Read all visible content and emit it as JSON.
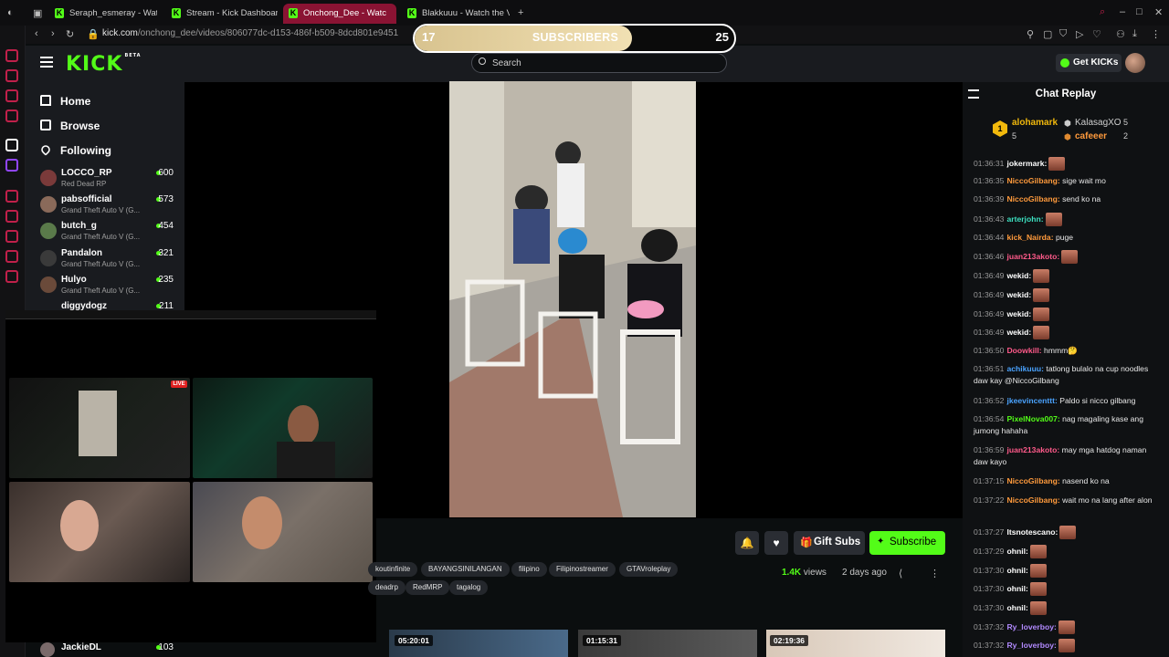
{
  "browser": {
    "tabs": [
      {
        "label": "Seraph_esmeray - Watch"
      },
      {
        "label": "Stream - Kick Dashboard"
      },
      {
        "label": "Onchong_Dee - Watc"
      },
      {
        "label": "Blakkuuu - Watch the VOD"
      }
    ],
    "url_host": "kick.com",
    "url_path": "/onchong_dee/videos/806077dc-d153-486f-b509-8dcd801e9451"
  },
  "overlay": {
    "sub_current": "17",
    "sub_label": "SUBSCRIBERS",
    "sub_goal": "25",
    "sub_progress": 0.68
  },
  "header": {
    "logo": "KICK",
    "logo_tag": "BETA",
    "search_placeholder": "Search",
    "get_kicks": "Get KICKs"
  },
  "sidebar": {
    "nav": [
      {
        "label": "Home"
      },
      {
        "label": "Browse"
      },
      {
        "label": "Following"
      }
    ],
    "channels": [
      {
        "name": "LOCCO_RP",
        "game": "Red Dead RP",
        "viewers": "600"
      },
      {
        "name": "pabsofficial",
        "game": "Grand Theft Auto V (G...",
        "viewers": "573"
      },
      {
        "name": "butch_g",
        "game": "Grand Theft Auto V (G...",
        "viewers": "454"
      },
      {
        "name": "Pandalon",
        "game": "Grand Theft Auto V (G...",
        "viewers": "321"
      },
      {
        "name": "Hulyo",
        "game": "Grand Theft Auto V (G...",
        "viewers": "235"
      },
      {
        "name": "diggydogz",
        "game": "",
        "viewers": "211"
      },
      {
        "name": "JackieDL",
        "game": "",
        "viewers": "103"
      }
    ]
  },
  "cam": {
    "live": "LIVE"
  },
  "video_actions": {
    "gift_subs": "Gift Subs",
    "subscribe": "Subscribe",
    "views_count": "1.4K",
    "views_word": "views",
    "ago": "2 days ago"
  },
  "tags": [
    "koutinfinite",
    "BAYANGSINILANGAN",
    "filipino",
    "Filipinostreamer",
    "GTAVroleplay",
    "deadrp",
    "RedMRP",
    "tagalog"
  ],
  "thumbs": [
    "05:20:01",
    "01:15:31",
    "02:19:36"
  ],
  "chat": {
    "title": "Chat Replay",
    "leaders": [
      {
        "name": "alohamark",
        "count": "5"
      },
      {
        "name": "KalasagXO",
        "count": "5"
      },
      {
        "name": "cafeeer",
        "count": "2"
      }
    ],
    "messages": [
      {
        "ts": "01:36:31",
        "user": "jokermark:",
        "text": "",
        "emote": true,
        "color": "white"
      },
      {
        "ts": "01:36:35",
        "user": "NiccoGilbang:",
        "text": "sige wait mo",
        "emote": false,
        "color": "orange"
      },
      {
        "ts": "01:36:39",
        "user": "NiccoGilbang:",
        "text": "send ko na",
        "emote": false,
        "color": "orange"
      },
      {
        "ts": "01:36:43",
        "user": "arterjohn:",
        "text": "",
        "emote": true,
        "color": "teal"
      },
      {
        "ts": "01:36:44",
        "user": "kick_Nairda:",
        "text": "puge",
        "emote": false,
        "color": "orange"
      },
      {
        "ts": "01:36:46",
        "user": "juan213akoto:",
        "text": "",
        "emote": true,
        "color": "pink"
      },
      {
        "ts": "01:36:49",
        "user": "wekid:",
        "text": "",
        "emote": true,
        "color": "white"
      },
      {
        "ts": "01:36:49",
        "user": "wekid:",
        "text": "",
        "emote": true,
        "color": "white"
      },
      {
        "ts": "01:36:49",
        "user": "wekid:",
        "text": "",
        "emote": true,
        "color": "white"
      },
      {
        "ts": "01:36:49",
        "user": "wekid:",
        "text": "",
        "emote": true,
        "color": "white"
      },
      {
        "ts": "01:36:50",
        "user": "Doowkill:",
        "text": "hmmm🤔",
        "emote": false,
        "color": "pink"
      },
      {
        "ts": "01:36:51",
        "user": "achikuuu:",
        "text": "tatlong bulalo na cup noodles daw kay @NiccoGilbang",
        "emote": false,
        "color": "blue"
      },
      {
        "ts": "01:36:52",
        "user": "jkeevincenttt:",
        "text": "Paldo si nicco gilbang",
        "emote": false,
        "color": "blue"
      },
      {
        "ts": "01:36:54",
        "user": "PixelNova007:",
        "text": "nag magaling kase ang jumong hahaha",
        "emote": false,
        "color": "green"
      },
      {
        "ts": "01:36:59",
        "user": "juan213akoto:",
        "text": "may mga hatdog naman daw kayo",
        "emote": false,
        "color": "pink"
      },
      {
        "ts": "01:37:15",
        "user": "NiccoGilbang:",
        "text": "nasend ko na",
        "emote": false,
        "color": "orange"
      },
      {
        "ts": "01:37:22",
        "user": "NiccoGilbang:",
        "text": "wait mo na lang after alon",
        "emote": false,
        "color": "orange"
      },
      {
        "ts": "01:37:27",
        "user": "Itsnotescano:",
        "text": "",
        "emote": true,
        "color": "white"
      },
      {
        "ts": "01:37:29",
        "user": "ohnil:",
        "text": "",
        "emote": true,
        "color": "white"
      },
      {
        "ts": "01:37:30",
        "user": "ohnil:",
        "text": "",
        "emote": true,
        "color": "white"
      },
      {
        "ts": "01:37:30",
        "user": "ohnil:",
        "text": "",
        "emote": true,
        "color": "white"
      },
      {
        "ts": "01:37:30",
        "user": "ohnil:",
        "text": "",
        "emote": true,
        "color": "white"
      },
      {
        "ts": "01:37:32",
        "user": "Ry_loverboy:",
        "text": "",
        "emote": true,
        "color": "purple"
      },
      {
        "ts": "01:37:32",
        "user": "Ry_loverboy:",
        "text": "",
        "emote": true,
        "color": "purple"
      }
    ]
  },
  "colors": {
    "brand": "#53fc18",
    "active_tab": "#8a1333",
    "panel": "#191b1f"
  }
}
